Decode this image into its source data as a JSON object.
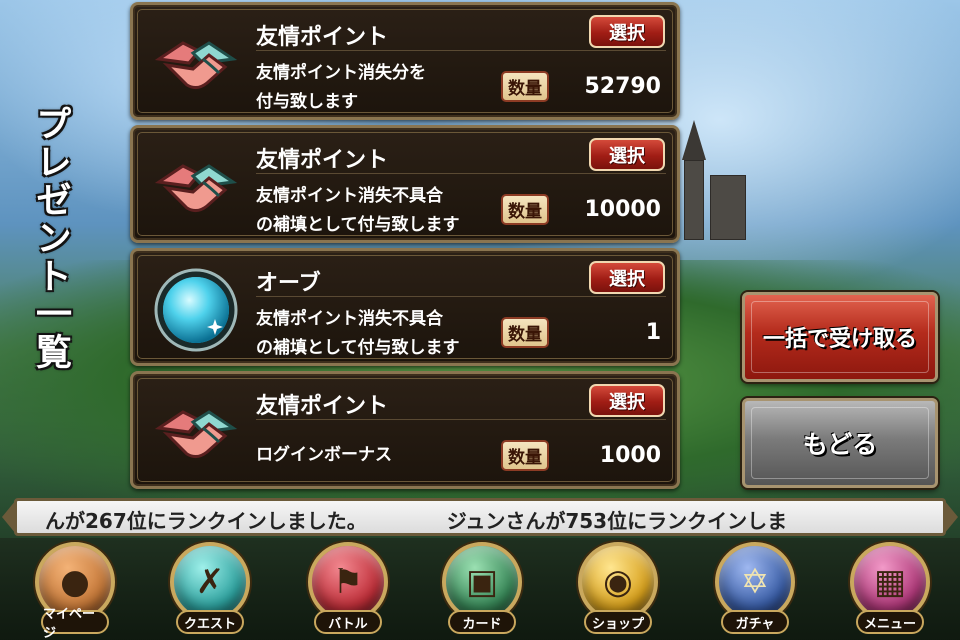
{
  "screen_title": "プレゼント一覧",
  "presents": [
    {
      "name": "友情ポイント",
      "icon": "handshake-icon",
      "description_lines": [
        "友情ポイント消失分を",
        "付与致します"
      ],
      "select_label": "選択",
      "quantity_label": "数量",
      "quantity": "52790"
    },
    {
      "name": "友情ポイント",
      "icon": "handshake-icon",
      "description_lines": [
        "友情ポイント消失不具合",
        "の補填として付与致します"
      ],
      "select_label": "選択",
      "quantity_label": "数量",
      "quantity": "10000"
    },
    {
      "name": "オーブ",
      "icon": "orb-icon",
      "description_lines": [
        "友情ポイント消失不具合",
        "の補填として付与致します"
      ],
      "select_label": "選択",
      "quantity_label": "数量",
      "quantity": "1"
    },
    {
      "name": "友情ポイント",
      "icon": "handshake-icon",
      "description_lines": [
        "ログインボーナス"
      ],
      "select_label": "選択",
      "quantity_label": "数量",
      "quantity": "1000"
    }
  ],
  "actions": {
    "receive_all_label": "一括で受け取る",
    "back_label": "もどる"
  },
  "ticker": {
    "messages": [
      "んが267位にランクインしました。",
      "ジュンさんが753位にランクインしま"
    ]
  },
  "nav": [
    {
      "label": "マイページ",
      "icon": "person-icon",
      "color": "#c77a3a"
    },
    {
      "label": "クエスト",
      "icon": "crossed-swords-icon",
      "color": "#2fa3a0"
    },
    {
      "label": "バトル",
      "icon": "flag-icon",
      "color": "#c0303a"
    },
    {
      "label": "カード",
      "icon": "card-icon",
      "color": "#3a8a5a"
    },
    {
      "label": "ショップ",
      "icon": "money-bag-icon",
      "color": "#d9a21e"
    },
    {
      "label": "ガチャ",
      "icon": "magic-circle-icon",
      "color": "#3b5fa8"
    },
    {
      "label": "メニュー",
      "icon": "grid-icon",
      "color": "#b03a7a"
    }
  ]
}
